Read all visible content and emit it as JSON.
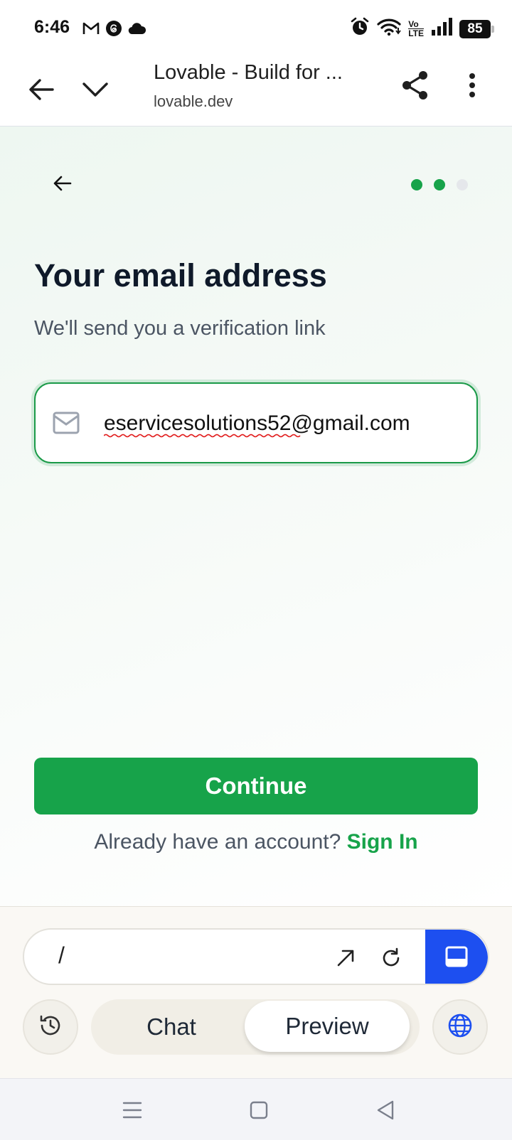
{
  "status_bar": {
    "time": "6:46",
    "left_icons": [
      "gmail-icon",
      "threads-icon",
      "cloud-icon"
    ],
    "right_icons": [
      "alarm-icon",
      "wifi-icon",
      "volte-icon",
      "signal-icon"
    ],
    "volte_text_top": "Vo",
    "volte_text_bottom": "LTE",
    "battery": "85"
  },
  "browser": {
    "title": "Lovable - Build for ...",
    "url": "lovable.dev"
  },
  "page": {
    "progress": {
      "total_steps": 3,
      "completed_steps": 2
    },
    "heading": "Your email address",
    "subheading": "We'll send you a verification link",
    "email": {
      "value": "eservicesolutions52@gmail.com",
      "icon": "mail-icon"
    },
    "continue_label": "Continue",
    "signin_prompt": "Already have an account?",
    "signin_link": "Sign In"
  },
  "app_panel": {
    "command_text": "/",
    "tabs": [
      {
        "label": "Chat",
        "active": false
      },
      {
        "label": "Preview",
        "active": true
      }
    ]
  },
  "colors": {
    "accent_green": "#17a34a",
    "accent_blue": "#1d4ff0",
    "heading_text": "#0f1a2a"
  }
}
